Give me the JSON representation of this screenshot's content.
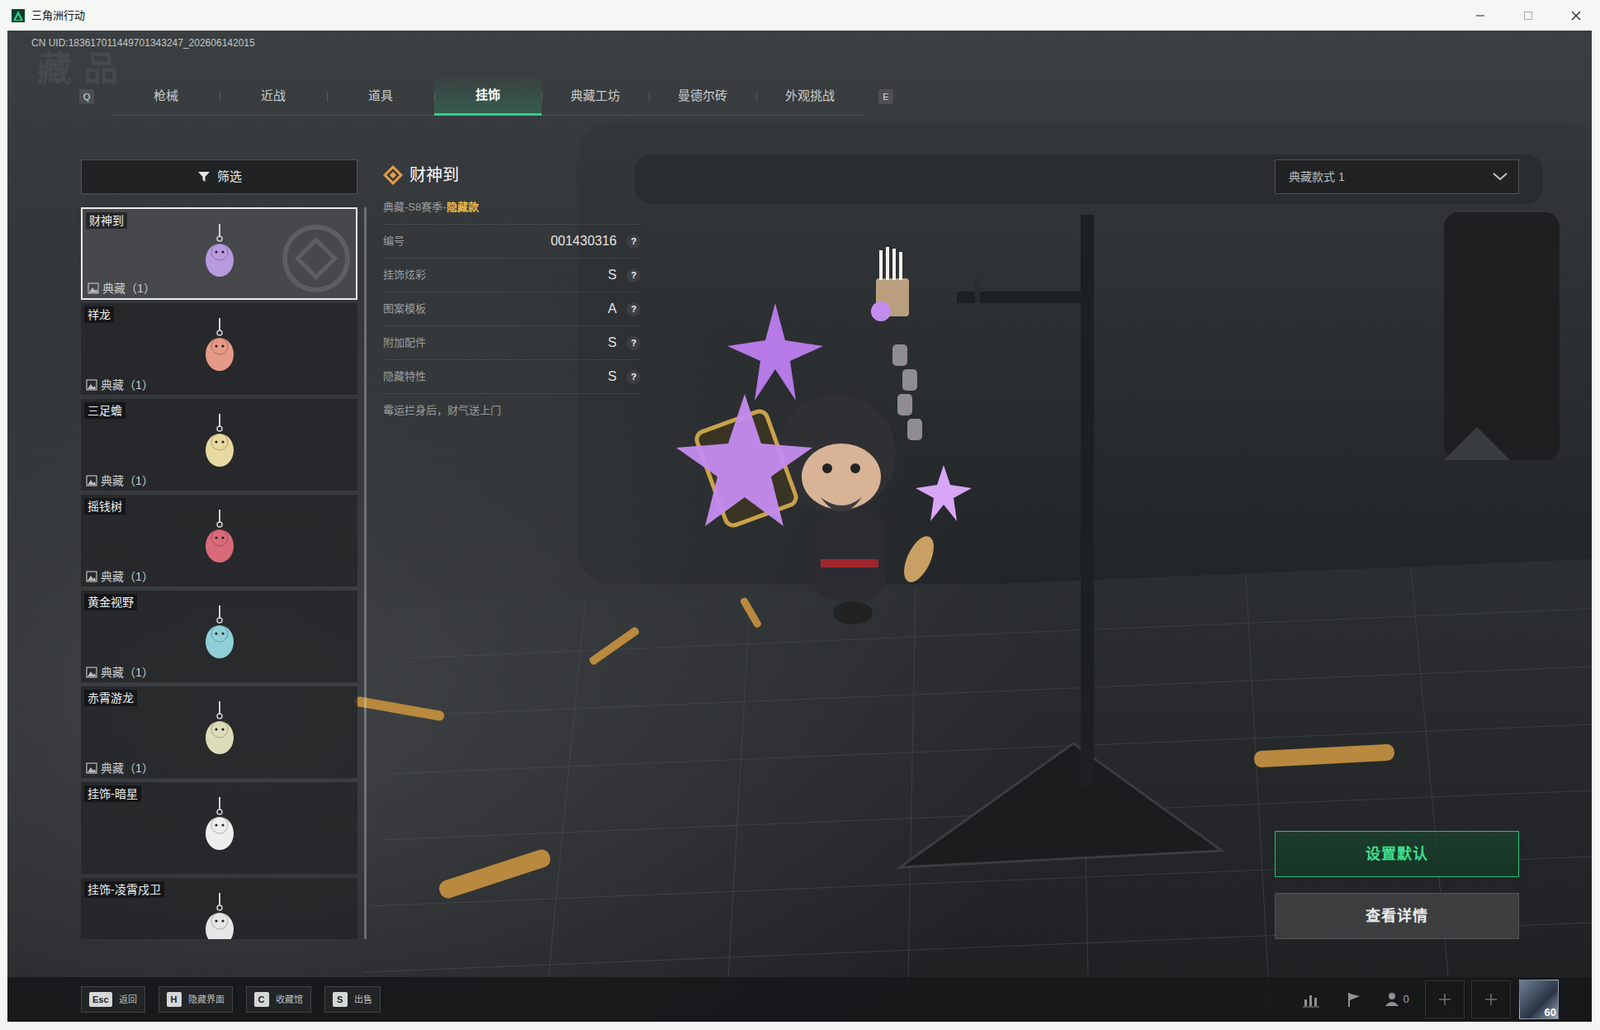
{
  "window": {
    "title": "三角洲行动"
  },
  "uid": "CN UID:183617011449701343247_202606142015",
  "watermark": "藏品",
  "tabs": {
    "prev_key": "Q",
    "next_key": "E",
    "items": [
      {
        "label": "枪械",
        "selected": false
      },
      {
        "label": "近战",
        "selected": false
      },
      {
        "label": "道具",
        "selected": false
      },
      {
        "label": "挂饰",
        "selected": true
      },
      {
        "label": "典藏工坊",
        "selected": false
      },
      {
        "label": "曼德尔砖",
        "selected": false
      },
      {
        "label": "外观挑战",
        "selected": false
      }
    ]
  },
  "filter": {
    "label": "筛选"
  },
  "items": [
    {
      "name": "财神到",
      "count": "典藏（1）",
      "selected": true
    },
    {
      "name": "祥龙",
      "count": "典藏（1）",
      "selected": false
    },
    {
      "name": "三足蟾",
      "count": "典藏（1）",
      "selected": false
    },
    {
      "name": "摇钱树",
      "count": "典藏（1）",
      "selected": false
    },
    {
      "name": "黄金视野",
      "count": "典藏（1）",
      "selected": false
    },
    {
      "name": "赤霄游龙",
      "count": "典藏（1）",
      "selected": false
    },
    {
      "name": "挂饰-暗星",
      "selected": false
    },
    {
      "name": "挂饰-凌霄戍卫",
      "selected": false
    }
  ],
  "detail": {
    "title": "财神到",
    "series": "典藏-S8赛季-",
    "rarity": "隐藏款",
    "rows": [
      {
        "label": "编号",
        "value": "001430316",
        "help": "?"
      },
      {
        "label": "挂饰炫彩",
        "value": "S",
        "help": "?"
      },
      {
        "label": "图案模板",
        "value": "A",
        "help": "?"
      },
      {
        "label": "附加配件",
        "value": "S",
        "help": "?"
      },
      {
        "label": "隐藏特性",
        "value": "S",
        "help": "?"
      }
    ],
    "description": "霉运拦身后，财气送上门"
  },
  "style_select": {
    "value": "典藏款式 1"
  },
  "buttons": [
    {
      "label": "设置默认",
      "kind": "primary"
    },
    {
      "label": "查看详情",
      "kind": "secondary"
    }
  ],
  "hotkeys": [
    {
      "key": "Esc",
      "label": "返回"
    },
    {
      "key": "H",
      "label": "隐藏界面"
    },
    {
      "key": "C",
      "label": "收藏馆"
    },
    {
      "key": "S",
      "label": "出售"
    }
  ],
  "status": {
    "friends": "0",
    "level": "60"
  }
}
